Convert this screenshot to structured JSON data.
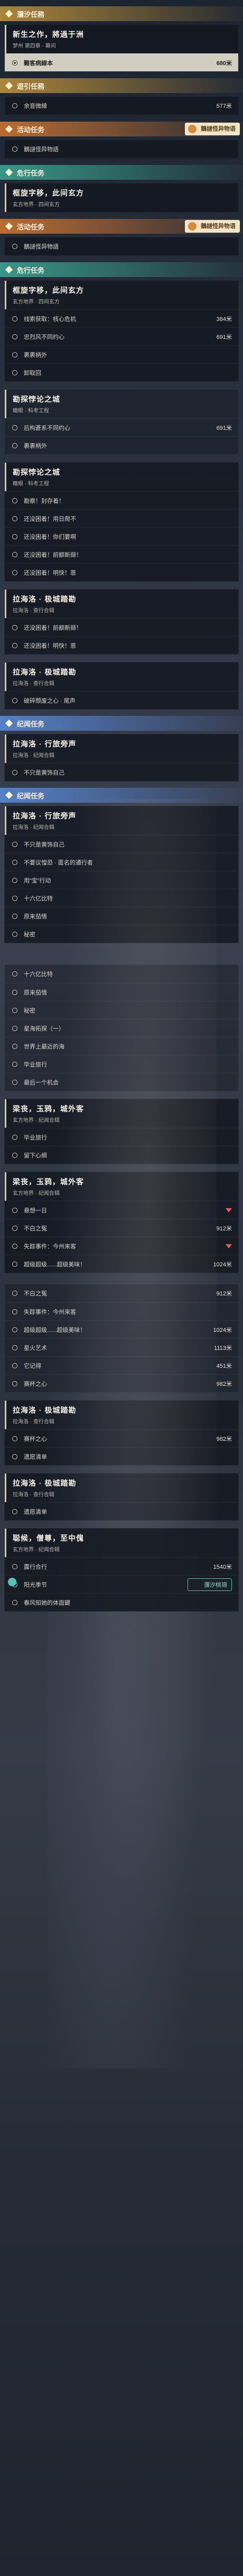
{
  "sec_lily": {
    "label": "瀰汐任務"
  },
  "q_newlife": {
    "title": "新生之作，將過于洲",
    "sub": "梦州 第四章 - 幕间",
    "row": {
      "label": "難客病線本",
      "dist": "680米"
    }
  },
  "sec_daily": {
    "label": "遊引任務"
  },
  "daily_row": {
    "label": "余音微縁",
    "dist": "577米"
  },
  "sec_event1": {
    "label": "活动任务",
    "badge": "鵝謎怪异物语"
  },
  "event1_row": {
    "label": "鵝謎怪异物語"
  },
  "sec_story1": {
    "label": "危行任务"
  },
  "story1": {
    "title": "框旋字移，此间玄方",
    "sub": "玄方地界 · 四间玄方"
  },
  "sec_event2": {
    "label": "活动任务",
    "badge": "鵝謎怪异物语"
  },
  "event2_row": {
    "label": "鵝謎怪异物語"
  },
  "sec_story2": {
    "label": "危行任务"
  },
  "story2": {
    "title": "框旋字移，此间玄方",
    "sub": "玄方地界 · 四间玄方",
    "rows": [
      {
        "label": "线索获取：核心危机",
        "dist": "384米"
      },
      {
        "label": "忠烈风不同约心",
        "dist": "691米"
      },
      {
        "label": "裹裹柄外"
      },
      {
        "label": "卸取回"
      }
    ]
  },
  "story3": {
    "title": "勘探悖论之城",
    "sub": "瞰眼 · 科考工程"
  },
  "story3_rows": [
    {
      "label": "后构蒼系不同约心",
      "dist": "691米"
    },
    {
      "label": "裹裹柄外"
    }
  ],
  "story4": {
    "title": "勘探悖论之城",
    "sub": "瞰眼 · 科考工程",
    "rows": [
      {
        "label": "勘察！封存着！"
      },
      {
        "label": "还没困着！用日爬不"
      },
      {
        "label": "还没困着！你们要啊"
      },
      {
        "label": "还没困着！前额新撷！"
      },
      {
        "label": "还没困着！明快！恩"
      }
    ]
  },
  "story5": {
    "title": "拉海洛 · 极城踏勘",
    "sub": "拉海洛 · 查行合辑",
    "rows": [
      {
        "label": "还没困着！前额新撷！"
      },
      {
        "label": "还没困着！明快！恩"
      }
    ]
  },
  "story6": {
    "title": "拉海洛 · 极城踏勘",
    "sub": "拉海洛 · 查行合辑",
    "rows": [
      {
        "label": "破碎颓废之心 · 尾声"
      }
    ]
  },
  "sec_leg1": {
    "label": "纪闻任务"
  },
  "leg1": {
    "title": "拉海洛 · 行旅旁声",
    "sub": "拉海洛 · 纪闻合辑",
    "rows": [
      {
        "label": "不只是黄饰自己"
      }
    ]
  },
  "sec_leg2": {
    "label": "纪闻任务"
  },
  "leg2": {
    "title": "拉海洛 · 行旅旁声",
    "sub": "拉海洛 · 纪闻合辑",
    "rows": [
      {
        "label": "不只是黄饰自己"
      },
      {
        "label": "不要议惶恐 · 匿名的通行者"
      },
      {
        "label": "用“宝”行动"
      },
      {
        "label": "十六亿比特"
      },
      {
        "label": "原来茄情"
      },
      {
        "label": "秘密"
      }
    ]
  },
  "leg3_rows": [
    {
      "label": "十六亿比特"
    },
    {
      "label": "原来茄情"
    },
    {
      "label": "秘密"
    },
    {
      "label": "星海拓探（一）"
    },
    {
      "label": "世界上最近的海"
    },
    {
      "label": "毕业旅行"
    },
    {
      "label": "最后一个机会"
    }
  ],
  "leg4": {
    "title": "梁丧，玉鸦，城外客",
    "sub": "玄方地界 · 纪闻合辑",
    "rows": [
      {
        "label": "毕业旅行"
      },
      {
        "label": "留下心纲"
      }
    ]
  },
  "leg5": {
    "title": "梁丧，玉鸦，城外客",
    "sub": "玄方地界 · 纪闻合辑",
    "rows": [
      {
        "label": "悬想一日"
      },
      {
        "label": "不白之冤",
        "dist": "912米"
      },
      {
        "label": "失踪事件：今州来客"
      },
      {
        "label": "超级超级......超级美味！",
        "dist": "1024米"
      }
    ]
  },
  "leg6_rows": [
    {
      "label": "不白之冤",
      "dist": "912米"
    },
    {
      "label": "失踪事件：今州来客"
    },
    {
      "label": "超级超级......超级美味！",
      "dist": "1024米"
    },
    {
      "label": "星火艺术",
      "dist": "1113米"
    },
    {
      "label": "它记得",
      "dist": "451米"
    },
    {
      "label": "赛杯之心",
      "dist": "982米"
    }
  ],
  "leg7": {
    "title": "拉海洛 · 极城踏勘",
    "sub": "拉海洛 · 查行合辑",
    "rows": [
      {
        "label": "赛杯之心",
        "dist": "982米"
      },
      {
        "label": "遗愿清单"
      }
    ]
  },
  "leg8": {
    "title": "拉海洛 · 极城踏勘",
    "sub": "拉海洛 · 查行合辑",
    "rows": [
      {
        "label": "遗愿清单"
      }
    ]
  },
  "leg9": {
    "title": "聪候，僧尊，至中傀",
    "sub": "玄方地界 · 纪闻合辑",
    "rows": [
      {
        "label": "露行合行",
        "dist": "1540米"
      },
      {
        "label": "阳光季节"
      },
      {
        "label": "春风知她的体面鍵"
      }
    ],
    "badge": "瀰汐桃嶺"
  }
}
